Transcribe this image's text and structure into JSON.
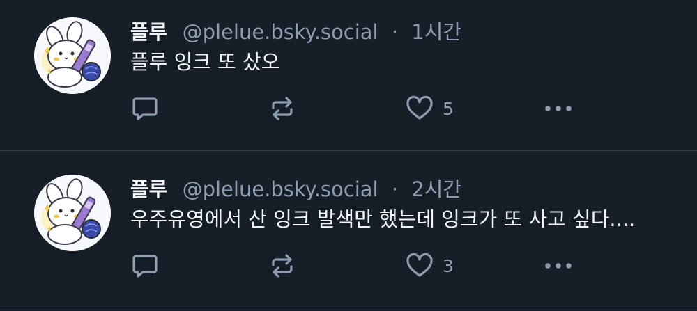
{
  "posts": [
    {
      "display_name": "플루",
      "handle": "@plelue.bsky.social",
      "separator": "·",
      "time": "1시간",
      "text": "플루 잉크 또 샀오",
      "like_count": "5"
    },
    {
      "display_name": "플루",
      "handle": "@plelue.bsky.social",
      "separator": "·",
      "time": "2시간",
      "text": "우주유영에서 산 잉크 발색만 했는데 잉크가 또 사고 싶다....",
      "like_count": "3"
    }
  ],
  "icons": {
    "reply": "speech-bubble-icon",
    "repost": "repost-arrows-icon",
    "like": "heart-outline-icon",
    "more": "ellipsis-icon"
  },
  "colors": {
    "background": "#161e27",
    "text_primary": "#f1f3f5",
    "text_secondary": "#8d9cb0",
    "divider": "#2e3a48",
    "icon": "#8d9cb0"
  }
}
